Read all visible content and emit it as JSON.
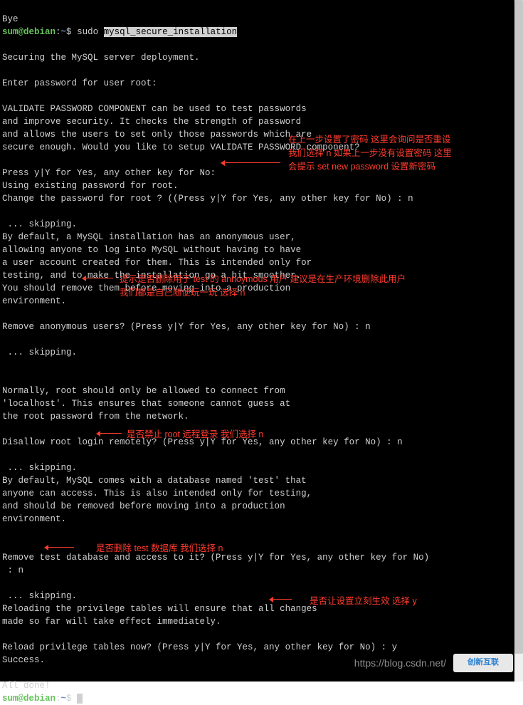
{
  "prompt": {
    "user": "sum@debian",
    "colon": ":",
    "tilde": "~",
    "dollar": "$ "
  },
  "lines": {
    "bye": "Bye",
    "sudo": "sudo ",
    "secure_cmd": "mysql_secure_installation",
    "blank": "",
    "securing": "Securing the MySQL server deployment.",
    "enter_pw": "Enter password for user root: ",
    "vp1": "VALIDATE PASSWORD COMPONENT can be used to test passwords",
    "vp2": "and improve security. It checks the strength of password",
    "vp3": "and allows the users to set only those passwords which are",
    "vp4": "secure enough. Would you like to setup VALIDATE PASSWORD component?",
    "press1": "Press y|Y for Yes, any other key for No: ",
    "using": "Using existing password for root.",
    "change": "Change the password for root ? ((Press y|Y for Yes, any other key for No) : n",
    "skip": " ... skipping.",
    "anon1": "By default, a MySQL installation has an anonymous user,",
    "anon2": "allowing anyone to log into MySQL without having to have",
    "anon3": "a user account created for them. This is intended only for",
    "anon4": "testing, and to make the installation go a bit smoother.",
    "anon5": "You should remove them before moving into a production",
    "anon6": "environment.",
    "remove_anon": "Remove anonymous users? (Press y|Y for Yes, any other key for No) : n",
    "norm1": "Normally, root should only be allowed to connect from",
    "norm2": "'localhost'. This ensures that someone cannot guess at",
    "norm3": "the root password from the network.",
    "disallow": "Disallow root login remotely? (Press y|Y for Yes, any other key for No) : n",
    "testdb1": "By default, MySQL comes with a database named 'test' that",
    "testdb2": "anyone can access. This is also intended only for testing,",
    "testdb3": "and should be removed before moving into a production",
    "testdb4": "environment.",
    "remove_test": "Remove test database and access to it? (Press y|Y for Yes, any other key for No)",
    "remove_test2": " : n",
    "reload1": "Reloading the privilege tables will ensure that all changes",
    "reload2": "made so far will take effect immediately.",
    "reload_q": "Reload privilege tables now? (Press y|Y for Yes, any other key for No) : y",
    "success": "Success.",
    "done": "All done! "
  },
  "annotations": {
    "a1l1": "在上一步设置了密码 这里会询问是否重设",
    "a1l2": "我们选择 n 如果上一步没有设置密码 这里",
    "a1l3": "会提示 set new password 设置新密码",
    "a2l1": "提示是否删除用于 test 的 annoymous 用户 建议是在生产环境删除此用户",
    "a2l2": "我们都是自己随便玩一玩 选择 n",
    "a3": "是否禁止 root 远程登录 我们选择 n",
    "a4": "是否删除 test 数据库 我们选择 n",
    "a5": "是否让设置立刻生效 选择 y"
  },
  "watermark": {
    "url": "https://blog.csdn.net/",
    "logo": "创新互联"
  }
}
